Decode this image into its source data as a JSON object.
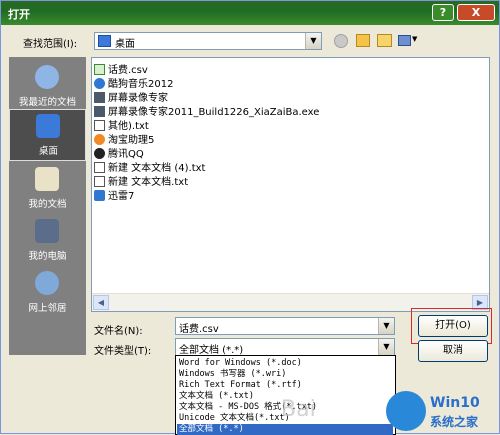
{
  "window": {
    "title": "打开",
    "help_label": "?",
    "close_label": "X"
  },
  "lookin": {
    "label": "查找范围(I):",
    "value": "桌面"
  },
  "places": [
    {
      "label": "我最近的文档",
      "icon": "recent-documents-icon"
    },
    {
      "label": "桌面",
      "icon": "desktop-icon"
    },
    {
      "label": "我的文档",
      "icon": "my-documents-icon"
    },
    {
      "label": "我的电脑",
      "icon": "my-computer-icon"
    },
    {
      "label": "网上邻居",
      "icon": "network-places-icon"
    }
  ],
  "files": [
    {
      "name": "话费.csv",
      "icon": "csv-file-icon"
    },
    {
      "name": "酷狗音乐2012",
      "icon": "shortcut-icon"
    },
    {
      "name": "屏幕录像专家",
      "icon": "shortcut-icon"
    },
    {
      "name": "屏幕录像专家2011_Build1226_XiaZaiBa.exe",
      "icon": "exe-file-icon"
    },
    {
      "name": "其他).txt",
      "icon": "txt-file-icon"
    },
    {
      "name": "淘宝助理5",
      "icon": "shortcut-icon"
    },
    {
      "name": "腾讯QQ",
      "icon": "qq-icon"
    },
    {
      "name": "新建 文本文档 (4).txt",
      "icon": "txt-file-icon"
    },
    {
      "name": "新建 文本文档.txt",
      "icon": "txt-file-icon"
    },
    {
      "name": "迅雷7",
      "icon": "shortcut-icon"
    }
  ],
  "filename": {
    "label": "文件名(N):",
    "value": "话费.csv"
  },
  "filetype": {
    "label": "文件类型(T):",
    "value": "全部文档 (*.*)",
    "options": [
      "Word for Windows (*.doc)",
      "Windows 书写器 (*.wri)",
      "Rich Text Format (*.rtf)",
      "文本文档 (*.txt)",
      "文本文档 - MS-DOS 格式(*.txt)",
      "Unicode 文本文档(*.txt)",
      "全部文档 (*.*)"
    ]
  },
  "buttons": {
    "open": "打开(O)",
    "cancel": "取消"
  },
  "watermark": {
    "line1": "Win10",
    "line2": "系统之家",
    "baidu": "Bai"
  },
  "colors": {
    "titlebar": "#2b6a22",
    "places_bg": "#808080",
    "highlight": "#316ac5"
  }
}
